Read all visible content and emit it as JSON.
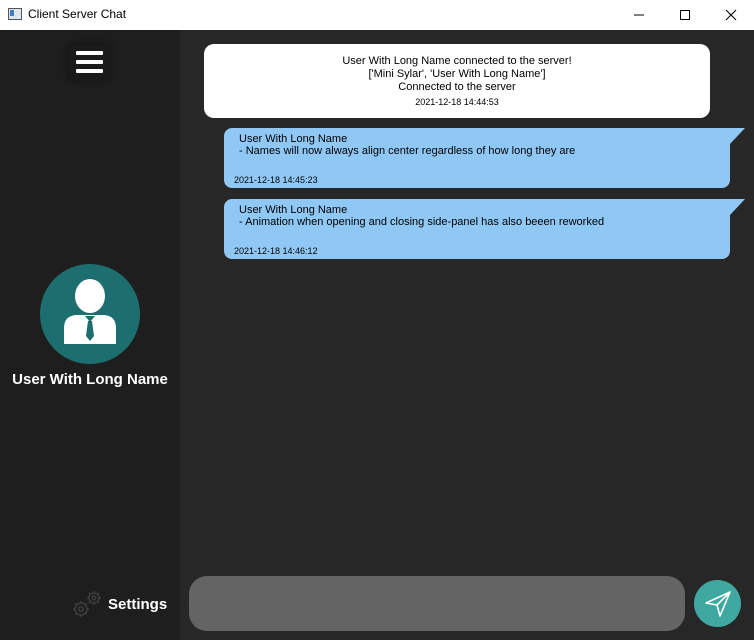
{
  "window": {
    "title": "Client Server Chat"
  },
  "sidebar": {
    "username": "User With Long Name",
    "settings_label": "Settings"
  },
  "messages": {
    "server": {
      "lines": [
        "User With Long Name connected to the server!",
        "['Mini Sylar', 'User With Long Name']",
        "Connected to the server"
      ],
      "timestamp": "2021-12-18 14:44:53"
    },
    "chat": [
      {
        "name": "User With Long Name",
        "text": " - Names will now always align center regardless of how long they are",
        "timestamp": "2021-12-18 14:45:23"
      },
      {
        "name": "User With Long Name",
        "text": " - Animation when opening and closing side-panel has also beeen reworked",
        "timestamp": "2021-12-18 14:46:12"
      }
    ]
  },
  "input": {
    "value": ""
  },
  "colors": {
    "sidebar_bg": "#1e1e1e",
    "chat_bg": "#272727",
    "bubble": "#90c8f5",
    "avatar": "#1d6f6f",
    "send_button": "#3fa9a1",
    "input_bg": "#646464"
  },
  "icons": {
    "menu": "hamburger-menu-icon",
    "avatar": "user-avatar-icon",
    "settings": "gear-icon",
    "send": "send-paper-plane-icon"
  }
}
